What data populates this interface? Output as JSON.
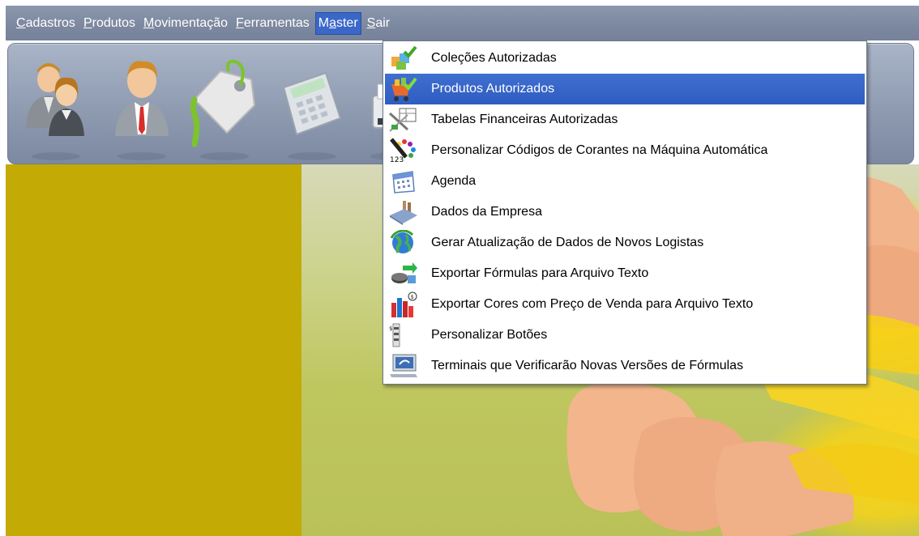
{
  "menubar": {
    "items": [
      {
        "label_u": "C",
        "label_rest": "adastros"
      },
      {
        "label_u": "P",
        "label_rest": "rodutos"
      },
      {
        "label_u": "M",
        "label_rest": "ovimentação"
      },
      {
        "label_u": "F",
        "label_rest": "erramentas"
      },
      {
        "label_pre": "M",
        "label_u": "a",
        "label_rest": "ster"
      },
      {
        "label_u": "S",
        "label_rest": "air"
      }
    ]
  },
  "toolbar": {
    "buttons": [
      {
        "icon": "users-icon"
      },
      {
        "icon": "user-icon"
      },
      {
        "icon": "price-tag-icon"
      },
      {
        "icon": "calculator-icon"
      },
      {
        "icon": "printer-icon"
      }
    ]
  },
  "dropdown": {
    "items": [
      {
        "label": "Coleções Autorizadas",
        "icon": "collections-check-icon"
      },
      {
        "label": "Produtos Autorizados",
        "icon": "products-check-icon",
        "selected": true
      },
      {
        "label": "Tabelas Financeiras Autorizadas",
        "icon": "financial-tables-icon"
      },
      {
        "label": "Personalizar Códigos de Corantes na Máquina Automática",
        "icon": "colorant-codes-icon"
      },
      {
        "label": "Agenda",
        "icon": "calendar-icon"
      },
      {
        "label": "Dados da Empresa",
        "icon": "company-building-icon"
      },
      {
        "label": "Gerar Atualização de Dados de Novos Logistas",
        "icon": "globe-update-icon"
      },
      {
        "label": "Exportar Fórmulas para Arquivo Texto",
        "icon": "export-formulas-icon"
      },
      {
        "label": "Exportar Cores com Preço de Venda para Arquivo Texto",
        "icon": "export-colors-price-icon"
      },
      {
        "label": "Personalizar Botões",
        "icon": "customize-buttons-icon"
      },
      {
        "label": "Terminais que Verificarão Novas Versões de Fórmulas",
        "icon": "terminals-monitor-icon"
      }
    ]
  },
  "colors": {
    "menubar_bg": "#7c889f",
    "selection": "#3a67c8",
    "olive_panel": "#c3aa05",
    "flower_yellow": "#f7d21c"
  }
}
